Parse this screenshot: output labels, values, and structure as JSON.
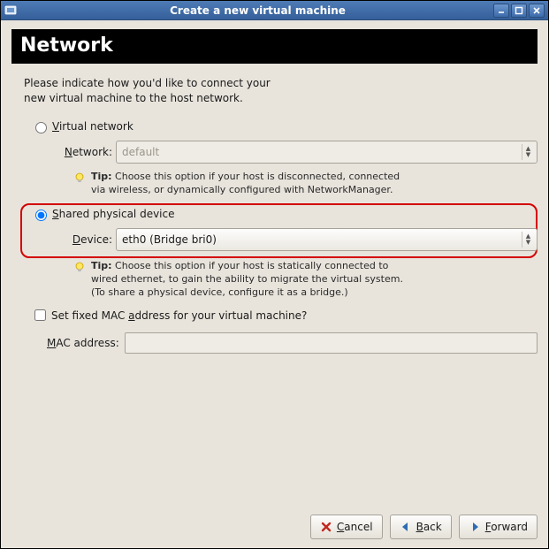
{
  "window": {
    "title": "Create a new virtual machine"
  },
  "heading": "Network",
  "intro_line1": "Please indicate how you'd like to connect your",
  "intro_line2": "new virtual machine to the host network.",
  "option_virtual": {
    "label_prefix": "V",
    "label_rest": "irtual network",
    "selected": false,
    "network_label_prefix": "N",
    "network_label_rest": "etwork:",
    "network_value": "default",
    "tip_prefix": "Tip:",
    "tip_line1": " Choose this option if your host is disconnected, connected",
    "tip_line2": "via wireless, or dynamically configured with NetworkManager."
  },
  "option_shared": {
    "label_prefix": "S",
    "label_rest": "hared physical device",
    "selected": true,
    "device_label_prefix": "D",
    "device_label_rest": "evice:",
    "device_value": "eth0 (Bridge bri0)",
    "tip_prefix": "Tip:",
    "tip_line1": " Choose this option if your host is statically connected to",
    "tip_line2": "wired ethernet, to gain the ability to migrate the virtual system.",
    "tip_line3": "(To share a physical device, configure it as a bridge.)"
  },
  "fixed_mac": {
    "label_pre": "Set fixed MAC ",
    "label_u": "a",
    "label_post": "ddress for your virtual machine?",
    "checked": false,
    "mac_label_prefix": "M",
    "mac_label_rest": "AC address:",
    "mac_value": ""
  },
  "buttons": {
    "cancel_u": "C",
    "cancel_rest": "ancel",
    "back_u": "B",
    "back_rest": "ack",
    "forward_u": "F",
    "forward_rest": "orward"
  }
}
